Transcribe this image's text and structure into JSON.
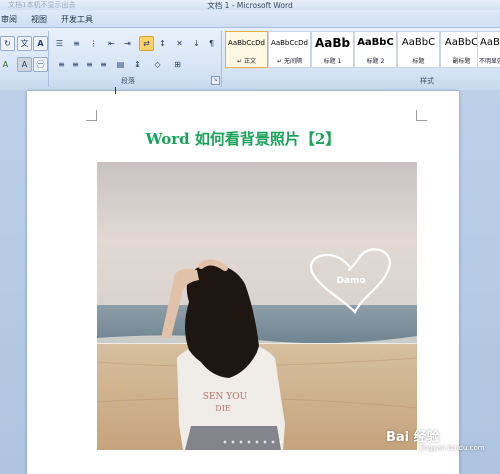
{
  "window": {
    "title": "文档 1 - Microsoft Word",
    "faded_text": "文档1本机不显示出去"
  },
  "menu": {
    "tabs": [
      "审阅",
      "视图",
      "开发工具"
    ]
  },
  "ribbon": {
    "paragraph_group_label": "段落",
    "styles_group_label": "样式",
    "font_buttons": {
      "phonetic": "文",
      "char_border": "A",
      "enclose": "㊀",
      "highlight": "A",
      "font_color": "A"
    },
    "styles": [
      {
        "sample": "AaBbCcDd",
        "name": "↵ 正文"
      },
      {
        "sample": "AaBbCcDd",
        "name": "↵ 无间隔"
      },
      {
        "sample": "AaBb",
        "name": "标题 1"
      },
      {
        "sample": "AaBbC",
        "name": "标题 2"
      },
      {
        "sample": "AaBbC",
        "name": "标题"
      },
      {
        "sample": "AaBbC",
        "name": "副标题"
      },
      {
        "sample": "AaBbC",
        "name": "不明显强"
      }
    ]
  },
  "document": {
    "title": "Word 如何看背景照片【2】",
    "cursor_mark": "I",
    "photo": {
      "shirt_text_line1": "SEN YOU",
      "shirt_text_line2": "DIE",
      "heart_text": "Damo"
    }
  },
  "watermark": {
    "text": "Bai 经验",
    "sub": "jingyan.baidu.com"
  },
  "colors": {
    "title_green": "#19a35a",
    "ribbon_blue": "#d9e6f6",
    "selected_style": "#e4b042"
  }
}
